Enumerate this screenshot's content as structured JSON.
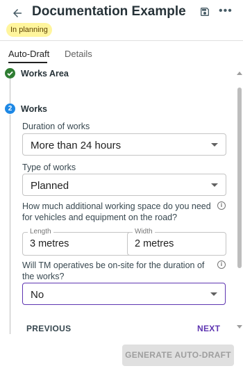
{
  "header": {
    "title": "Documentation Example",
    "status_badge": "In planning",
    "icons": [
      "arrow-left-icon",
      "save-icon",
      "more-horizontal-icon"
    ],
    "more_glyph": "•••"
  },
  "tabs": [
    {
      "label": "Auto-Draft",
      "active": true
    },
    {
      "label": "Details",
      "active": false
    }
  ],
  "steps": [
    {
      "number": "",
      "label": "Works Area",
      "status": "completed"
    },
    {
      "number": "2",
      "label": "Works",
      "status": "active"
    }
  ],
  "form": {
    "duration": {
      "label": "Duration of works",
      "value": "More than 24 hours"
    },
    "type": {
      "label": "Type of works",
      "value": "Planned"
    },
    "space_question": "How much additional working space do you need for vehicles and equipment on the road?",
    "length": {
      "label": "Length",
      "value": "3 metres"
    },
    "width": {
      "label": "Width",
      "value": "2 metres"
    },
    "tm_question": "Will TM operatives be on-site for the duration of the works?",
    "tm": {
      "value": "No"
    },
    "info_glyph": "i"
  },
  "nav": {
    "previous": "PREVIOUS",
    "next": "NEXT"
  },
  "generate_label": "GENERATE AUTO-DRAFT",
  "colors": {
    "badge_bg": "#fff59d",
    "step_done": "#2e7d32",
    "step_active": "#1e88e5",
    "accent": "#5e35b1"
  }
}
